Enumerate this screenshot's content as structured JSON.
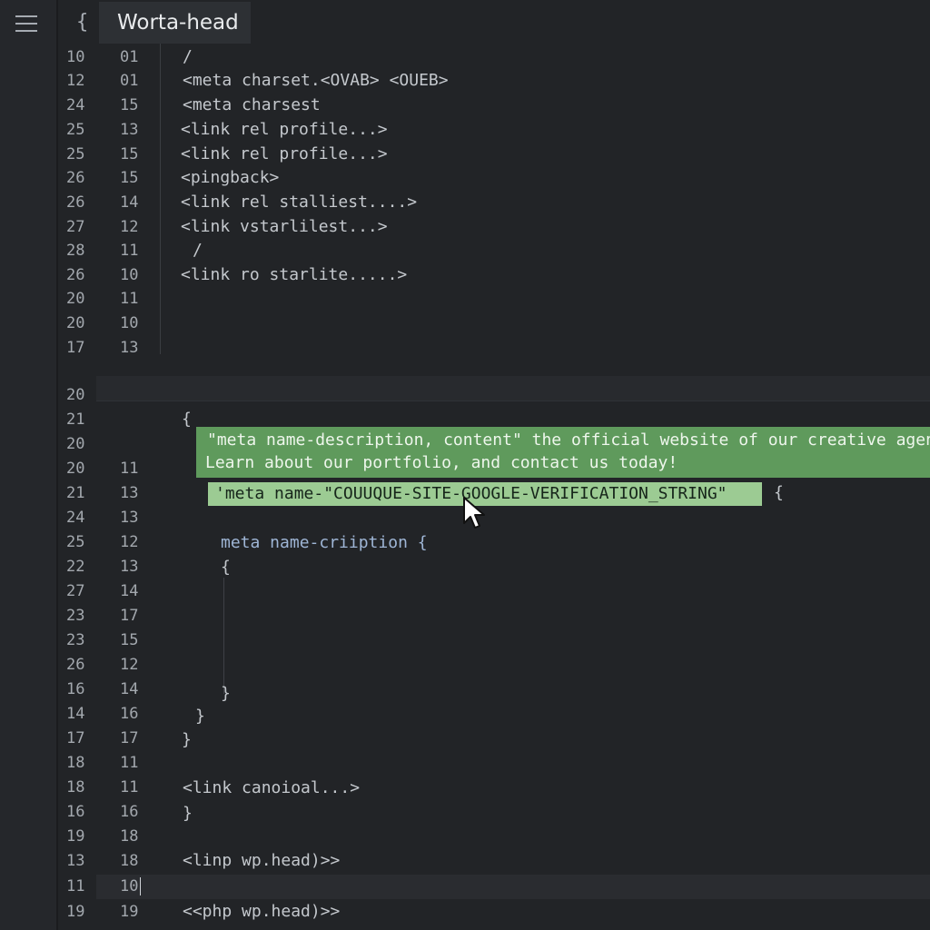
{
  "tab": {
    "brace": "{",
    "title": "Worta-head"
  },
  "lines": [
    {
      "n1": "10",
      "n2": "01",
      "text": "/"
    },
    {
      "n1": "12",
      "n2": "01",
      "text": "<meta charset.<OVAB> <OUEB>"
    },
    {
      "n1": "24",
      "n2": "15",
      "text": "<meta charsest"
    },
    {
      "n1": "25",
      "n2": "13",
      "text": "<link rel profile...>"
    },
    {
      "n1": "25",
      "n2": "15",
      "text": "<link rel profile...>"
    },
    {
      "n1": "26",
      "n2": "15",
      "text": "<pingback>"
    },
    {
      "n1": "26",
      "n2": "14",
      "text": "<link rel stalliest....>"
    },
    {
      "n1": "27",
      "n2": "12",
      "text": "<link vstarlilest...>"
    },
    {
      "n1": "28",
      "n2": "11",
      "text": "/"
    },
    {
      "n1": "26",
      "n2": "10",
      "text": "<link ro starlite.....>"
    },
    {
      "n1": "20",
      "n2": "11",
      "text": ""
    },
    {
      "n1": "20",
      "n2": "10",
      "text": ""
    },
    {
      "n1": "17",
      "n2": "13",
      "text": ""
    },
    {
      "n1": "20",
      "n2": "",
      "text": ""
    },
    {
      "n1": "21",
      "n2": "",
      "text": "{"
    },
    {
      "n1": "20",
      "n2": "",
      "text": ""
    },
    {
      "n1": "20",
      "n2": "11",
      "text": ""
    },
    {
      "n1": "21",
      "n2": "13",
      "text": ""
    },
    {
      "n1": "24",
      "n2": "13",
      "text": ""
    },
    {
      "n1": "25",
      "n2": "12",
      "text": "meta name-criiption {"
    },
    {
      "n1": "22",
      "n2": "13",
      "text": "{"
    },
    {
      "n1": "27",
      "n2": "14",
      "text": ""
    },
    {
      "n1": "23",
      "n2": "17",
      "text": ""
    },
    {
      "n1": "23",
      "n2": "15",
      "text": ""
    },
    {
      "n1": "26",
      "n2": "12",
      "text": ""
    },
    {
      "n1": "16",
      "n2": "14",
      "text": "}"
    },
    {
      "n1": "14",
      "n2": "16",
      "text": "}"
    },
    {
      "n1": "17",
      "n2": "17",
      "text": "}"
    },
    {
      "n1": "18",
      "n2": "11",
      "text": ""
    },
    {
      "n1": "18",
      "n2": "11",
      "text": "<link canoioal...>"
    },
    {
      "n1": "16",
      "n2": "16",
      "text": "}"
    },
    {
      "n1": "19",
      "n2": "18",
      "text": ""
    },
    {
      "n1": "13",
      "n2": "18",
      "text": "<linp wp.head)>>"
    },
    {
      "n1": "11",
      "n2": "10",
      "text": ""
    },
    {
      "n1": "19",
      "n2": "19",
      "text": "<<php wp.head)>>"
    }
  ],
  "highlights": {
    "description_line1": "\"meta name-description, content\" the official website of our creative agency.",
    "description_line2": "Learn about our portfolio, and contact us today!",
    "verification": "'meta name-\"COUUQUE-SITE-GOOGLE-VERIFICATION_STRING\"",
    "verification_brace": "{"
  },
  "colors": {
    "background": "#222427",
    "description_highlight": "#5f9a5c",
    "verification_highlight": "#9ccb93"
  }
}
